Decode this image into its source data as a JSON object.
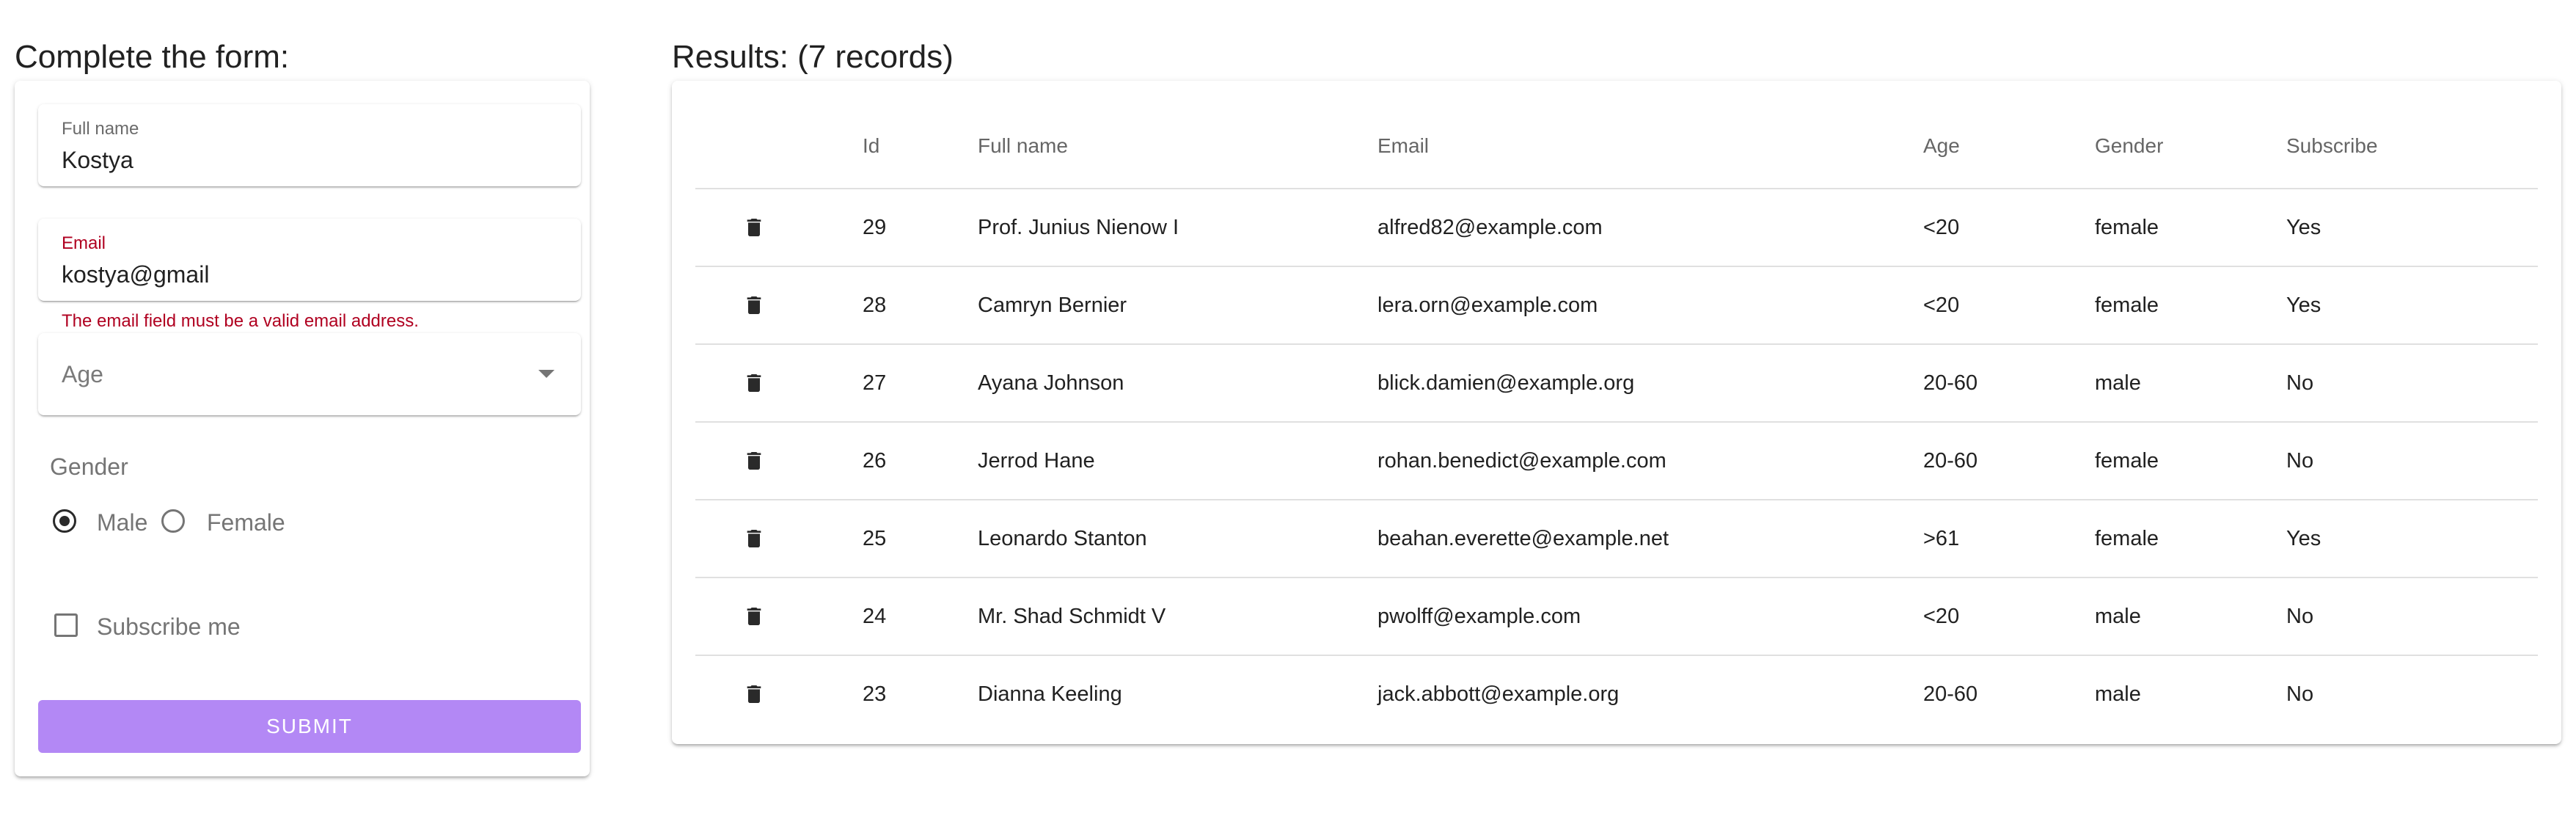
{
  "form": {
    "heading": "Complete the form:",
    "name_label": "Full name",
    "name_value": "Kostya",
    "email_label": "Email",
    "email_value": "kostya@gmail",
    "email_error": "The email field must be a valid email address.",
    "age_placeholder": "Age",
    "gender_label": "Gender",
    "gender_options": [
      "Male",
      "Female"
    ],
    "gender_selected": "Male",
    "subscribe_label": "Subscribe me",
    "subscribe_checked": false,
    "submit_label": "SUBMIT"
  },
  "results": {
    "heading": "Results: (7 records)",
    "columns": [
      "Id",
      "Full name",
      "Email",
      "Age",
      "Gender",
      "Subscribe"
    ],
    "rows": [
      {
        "id": "29",
        "name": "Prof. Junius Nienow I",
        "email": "alfred82@example.com",
        "age": "<20",
        "gender": "female",
        "subscribe": "Yes"
      },
      {
        "id": "28",
        "name": "Camryn Bernier",
        "email": "lera.orn@example.com",
        "age": "<20",
        "gender": "female",
        "subscribe": "Yes"
      },
      {
        "id": "27",
        "name": "Ayana Johnson",
        "email": "blick.damien@example.org",
        "age": "20-60",
        "gender": "male",
        "subscribe": "No"
      },
      {
        "id": "26",
        "name": "Jerrod Hane",
        "email": "rohan.benedict@example.com",
        "age": "20-60",
        "gender": "female",
        "subscribe": "No"
      },
      {
        "id": "25",
        "name": "Leonardo Stanton",
        "email": "beahan.everette@example.net",
        "age": ">61",
        "gender": "female",
        "subscribe": "Yes"
      },
      {
        "id": "24",
        "name": "Mr. Shad Schmidt V",
        "email": "pwolff@example.com",
        "age": "<20",
        "gender": "male",
        "subscribe": "No"
      },
      {
        "id": "23",
        "name": "Dianna Keeling",
        "email": "jack.abbott@example.org",
        "age": "20-60",
        "gender": "male",
        "subscribe": "No"
      }
    ]
  },
  "icons": {
    "delete": "trash-icon",
    "dropdown": "caret-down-icon"
  },
  "colors": {
    "error": "#b00020",
    "submit_button": "#b388f5"
  }
}
